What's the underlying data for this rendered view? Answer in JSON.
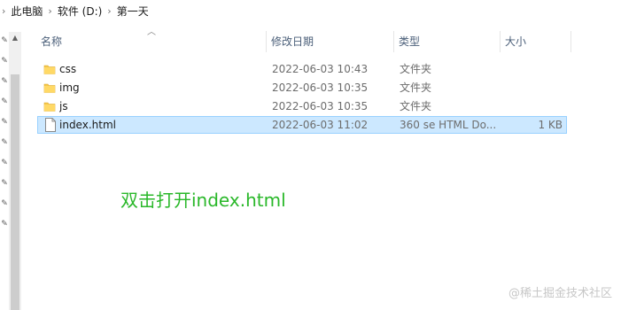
{
  "breadcrumb": {
    "items": [
      "此电脑",
      "软件 (D:)",
      "第一天"
    ]
  },
  "columns": {
    "name": "名称",
    "date": "修改日期",
    "type": "类型",
    "size": "大小"
  },
  "files": [
    {
      "name": "css",
      "date": "2022-06-03 10:43",
      "type": "文件夹",
      "size": "",
      "kind": "folder",
      "selected": false
    },
    {
      "name": "img",
      "date": "2022-06-03 10:35",
      "type": "文件夹",
      "size": "",
      "kind": "folder",
      "selected": false
    },
    {
      "name": "js",
      "date": "2022-06-03 10:35",
      "type": "文件夹",
      "size": "",
      "kind": "folder",
      "selected": false
    },
    {
      "name": "index.html",
      "date": "2022-06-03 11:02",
      "type": "360 se HTML Do...",
      "size": "1 KB",
      "kind": "file",
      "selected": true
    }
  ],
  "annotation": "双击打开index.html",
  "watermark": "@稀土掘金技术社区",
  "colors": {
    "annotation": "#2ab82a",
    "selection_bg": "#cce8ff",
    "selection_border": "#99d1ff",
    "folder": "#f5c84c"
  },
  "icons": {
    "folder": "folder-icon",
    "file": "html-file-icon",
    "chevron": "chevron-right-icon",
    "pin": "pin-icon"
  }
}
